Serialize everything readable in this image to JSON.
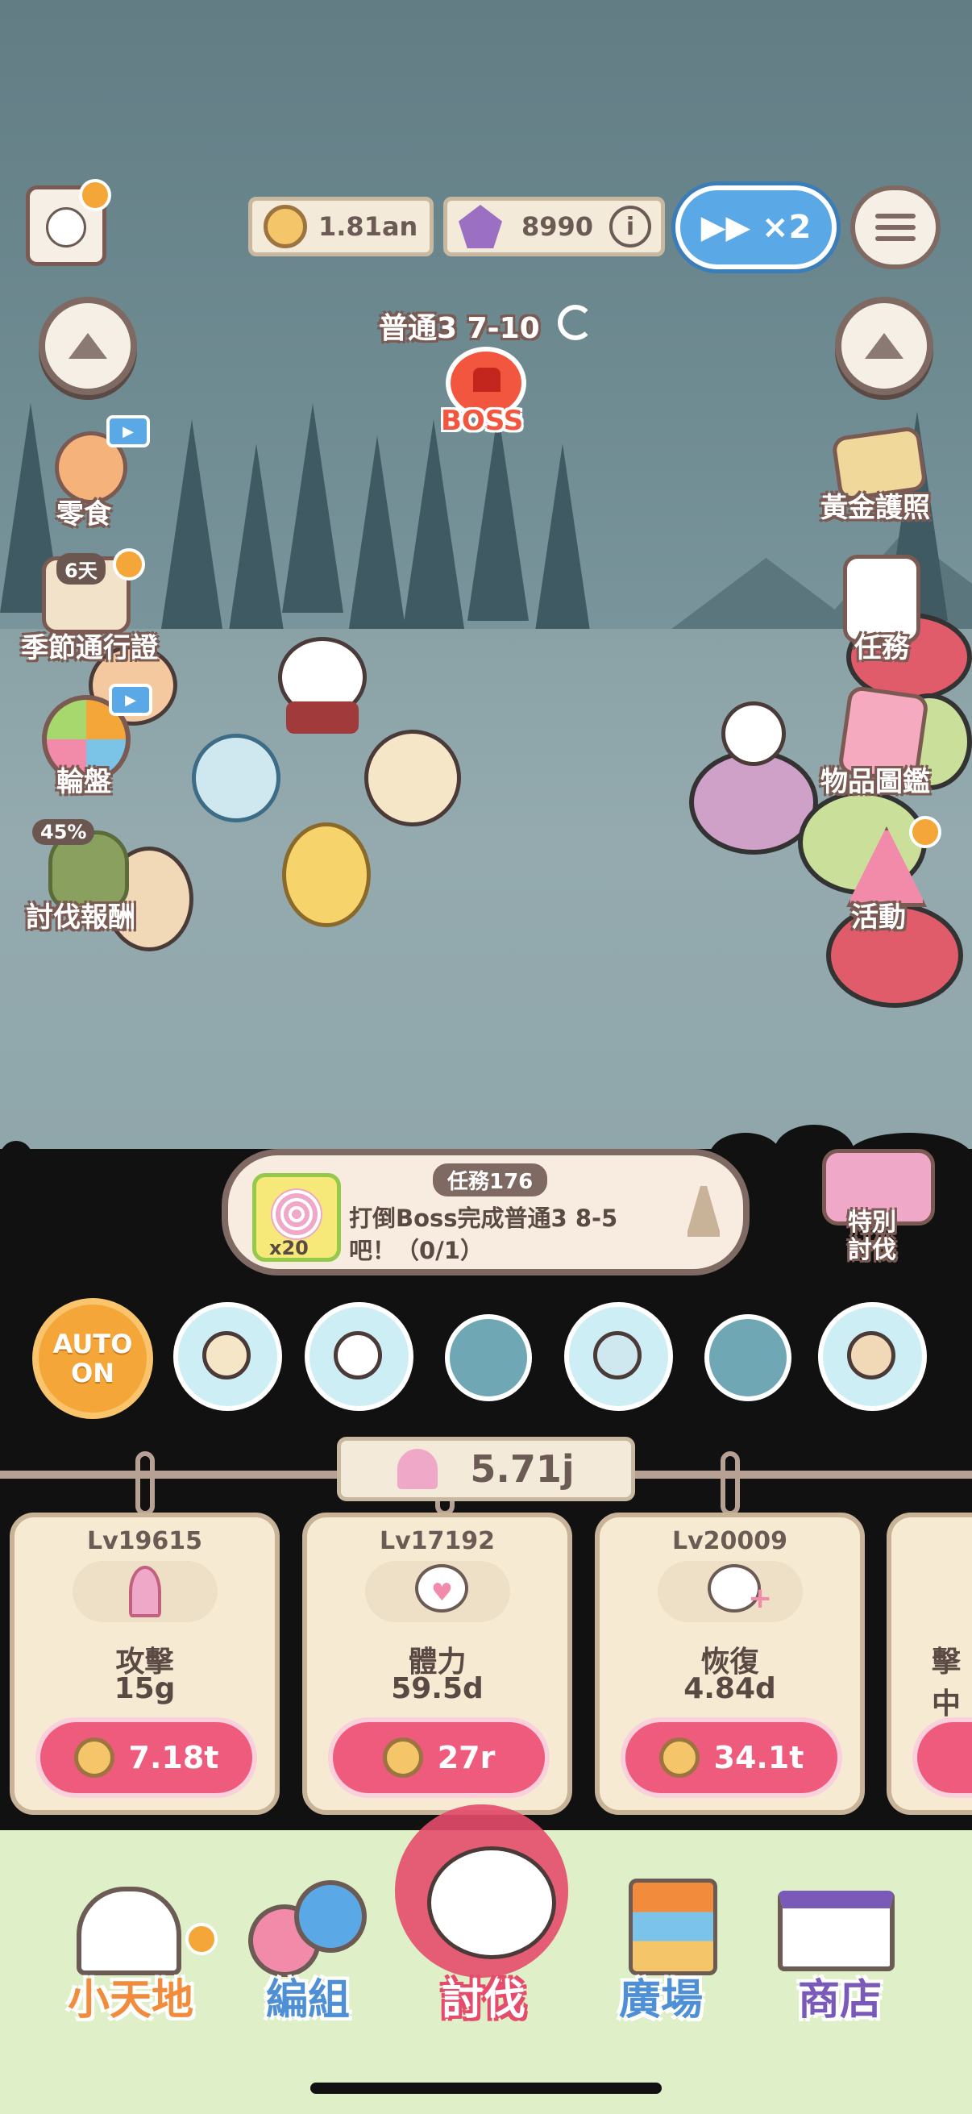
{
  "header": {
    "coins": "1.81an",
    "gems": "8990",
    "speed_label": "▶▶ ×2",
    "menu_icon": "list-icon",
    "profile_icon": "avatar-icon",
    "info_icon": "info-icon"
  },
  "stage": {
    "label": "普通3 7-10",
    "boss_label": "BOSS"
  },
  "left_menu": [
    {
      "label": "零食"
    },
    {
      "label": "季節通行證",
      "badge": "6天"
    },
    {
      "label": "輪盤"
    },
    {
      "label": "討伐報酬",
      "badge": "45%"
    }
  ],
  "right_menu": [
    {
      "label": "黃金護照"
    },
    {
      "label": "任務"
    },
    {
      "label": "物品圖鑑"
    },
    {
      "label": "活動"
    }
  ],
  "mission": {
    "tag": "任務176",
    "text": "打倒Boss完成普通3 8-5吧！（0/1）",
    "reward_count": "x20"
  },
  "special_hunt": {
    "label": "特別\n討伐"
  },
  "auto_button": {
    "line1": "AUTO",
    "line2": "ON"
  },
  "power": "5.71j",
  "upgrades": [
    {
      "level": "Lv19615",
      "name": "攻擊",
      "value": "15g",
      "cost": "7.18t",
      "icon": "attack-icon"
    },
    {
      "level": "Lv17192",
      "name": "體力",
      "value": "59.5d",
      "cost": "27r",
      "icon": "heart-icon"
    },
    {
      "level": "Lv20009",
      "name": "恢復",
      "value": "4.84d",
      "cost": "34.1t",
      "icon": "heal-icon"
    },
    {
      "level": "",
      "name": "擊中",
      "value": "",
      "cost": "",
      "icon": ""
    }
  ],
  "nav": [
    {
      "label": "小天地",
      "color": "#f28b3c"
    },
    {
      "label": "編組",
      "color": "#4f8fd6"
    },
    {
      "label": "討伐",
      "color": "#f5f5f5"
    },
    {
      "label": "廣場",
      "color": "#4f8fd6"
    },
    {
      "label": "商店",
      "color": "#7a5ab8"
    }
  ]
}
